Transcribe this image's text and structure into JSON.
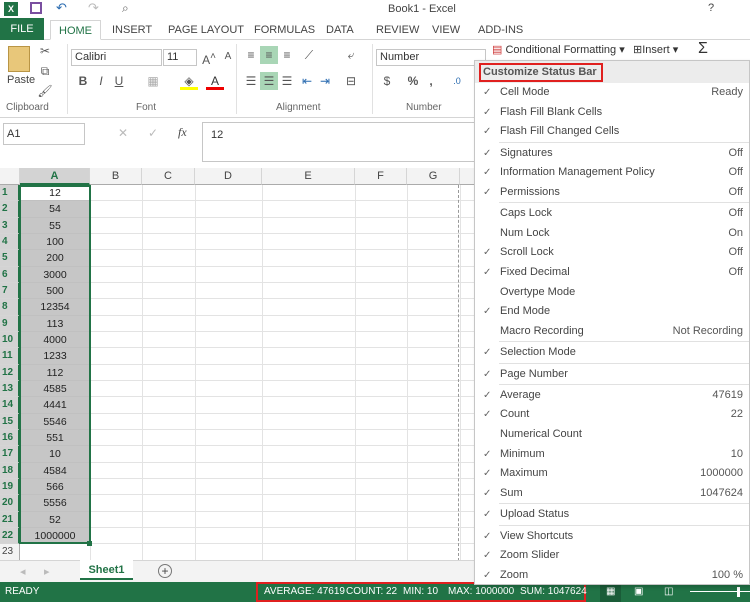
{
  "title": "Book1 - Excel",
  "tabs": [
    "FILE",
    "HOME",
    "INSERT",
    "PAGE LAYOUT",
    "FORMULAS",
    "DATA",
    "REVIEW",
    "VIEW",
    "ADD-INS"
  ],
  "ribbon": {
    "paste": "Paste",
    "font_name": "Calibri",
    "font_size": "11",
    "number_format": "Number",
    "conditional_formatting": "Conditional Formatting",
    "insert": "Insert",
    "groups": [
      "Clipboard",
      "Font",
      "Alignment",
      "Number"
    ],
    "bold": "B",
    "italic": "I",
    "underline": "U",
    "percent": "%",
    "comma": ",",
    "sigma": "Σ"
  },
  "formula_bar": {
    "name_box": "A1",
    "fx": "fx",
    "value": "12"
  },
  "columns": [
    "A",
    "B",
    "C",
    "D",
    "E",
    "F",
    "G"
  ],
  "rows": [
    12,
    54,
    55,
    100,
    200,
    3000,
    500,
    12354,
    113,
    4000,
    1233,
    112,
    4585,
    4441,
    5546,
    551,
    10,
    4584,
    566,
    5556,
    52,
    1000000
  ],
  "row_numbers": [
    "1",
    "2",
    "3",
    "4",
    "5",
    "6",
    "7",
    "8",
    "9",
    "10",
    "11",
    "12",
    "13",
    "14",
    "15",
    "16",
    "17",
    "18",
    "19",
    "20",
    "21",
    "22",
    "23"
  ],
  "sheet_tab": "Sheet1",
  "status": {
    "mode": "READY",
    "average": "AVERAGE: 47619",
    "count": "COUNT: 22",
    "min": "MIN: 10",
    "max": "MAX: 1000000",
    "sum": "SUM: 1047624"
  },
  "menu": {
    "title": "Customize Status Bar",
    "items": [
      {
        "label": "Cell Mode",
        "checked": true,
        "value": "Ready"
      },
      {
        "label": "Flash Fill Blank Cells",
        "checked": true,
        "value": ""
      },
      {
        "label": "Flash Fill Changed Cells",
        "checked": true,
        "value": "",
        "sep": true
      },
      {
        "label": "Signatures",
        "checked": true,
        "value": "Off"
      },
      {
        "label": "Information Management Policy",
        "checked": true,
        "value": "Off"
      },
      {
        "label": "Permissions",
        "checked": true,
        "value": "Off",
        "sep": true
      },
      {
        "label": "Caps Lock",
        "checked": false,
        "value": "Off"
      },
      {
        "label": "Num Lock",
        "checked": false,
        "value": "On"
      },
      {
        "label": "Scroll Lock",
        "checked": true,
        "value": "Off"
      },
      {
        "label": "Fixed Decimal",
        "checked": true,
        "value": "Off"
      },
      {
        "label": "Overtype Mode",
        "checked": false,
        "value": ""
      },
      {
        "label": "End Mode",
        "checked": true,
        "value": ""
      },
      {
        "label": "Macro Recording",
        "checked": false,
        "value": "Not Recording",
        "sep": true
      },
      {
        "label": "Selection Mode",
        "checked": true,
        "value": "",
        "sep": true
      },
      {
        "label": "Page Number",
        "checked": true,
        "value": "",
        "sep": true
      },
      {
        "label": "Average",
        "checked": true,
        "value": "47619"
      },
      {
        "label": "Count",
        "checked": true,
        "value": "22"
      },
      {
        "label": "Numerical Count",
        "checked": false,
        "value": ""
      },
      {
        "label": "Minimum",
        "checked": true,
        "value": "10"
      },
      {
        "label": "Maximum",
        "checked": true,
        "value": "1000000"
      },
      {
        "label": "Sum",
        "checked": true,
        "value": "1047624",
        "sep": true
      },
      {
        "label": "Upload Status",
        "checked": true,
        "value": "",
        "sep": true
      },
      {
        "label": "View Shortcuts",
        "checked": true,
        "value": ""
      },
      {
        "label": "Zoom Slider",
        "checked": true,
        "value": ""
      },
      {
        "label": "Zoom",
        "checked": true,
        "value": "100 %"
      }
    ]
  },
  "colors": {
    "accent": "#217346",
    "highlight": "#e0201f"
  }
}
